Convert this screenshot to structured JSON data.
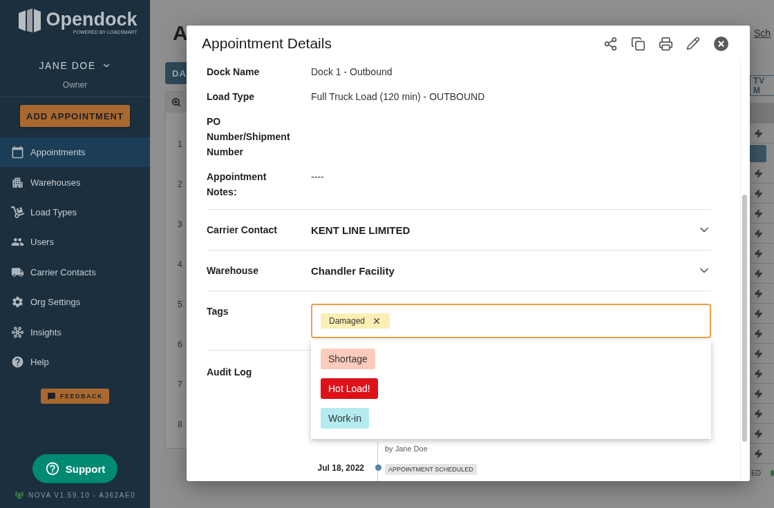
{
  "sidebar": {
    "logo": {
      "name": "Opendock",
      "tagline": "POWERED BY LOADSMART"
    },
    "user": {
      "name": "JANE DOE",
      "role": "Owner"
    },
    "add_button": "ADD APPOINTMENT",
    "nav": [
      {
        "label": "Appointments",
        "selected": true
      },
      {
        "label": "Warehouses",
        "selected": false
      },
      {
        "label": "Load Types",
        "selected": false
      },
      {
        "label": "Users",
        "selected": false
      },
      {
        "label": "Carrier Contacts",
        "selected": false
      },
      {
        "label": "Org Settings",
        "selected": false
      },
      {
        "label": "Insights",
        "selected": false
      },
      {
        "label": "Help",
        "selected": false
      }
    ],
    "feedback": "FEEDBACK",
    "support": "Support",
    "version": "NOVA V1.59.10 - A362AE0"
  },
  "background": {
    "heading": "A",
    "tab": "DA",
    "row_labels": [
      "1",
      "2",
      "3",
      "4",
      "5",
      "6",
      "7",
      "8"
    ],
    "top_link": "Sch",
    "side_button": "TV M",
    "status": "ED"
  },
  "modal": {
    "title": "Appointment Details",
    "details": [
      {
        "label": "Dock Name",
        "value": "Dock 1 - Outbound"
      },
      {
        "label": "Load Type",
        "value": "Full Truck Load (120 min) - OUTBOUND"
      },
      {
        "label": "PO Number/Shipment Number"
      },
      {
        "label": "Appointment Notes:",
        "value": "----"
      }
    ],
    "sections": [
      {
        "label": "Carrier Contact",
        "value": "KENT LINE LIMITED",
        "expanded": false
      },
      {
        "label": "Warehouse",
        "value": "Chandler Facility",
        "expanded": false
      }
    ],
    "tags": {
      "label": "Tags",
      "chips": [
        {
          "label": "Damaged",
          "color": "#fcefb4"
        }
      ],
      "options": [
        {
          "label": "Shortage",
          "color": "#fdcbbb"
        },
        {
          "label": "Hot Load!",
          "color": "#dd1219"
        },
        {
          "label": "Work-in",
          "color": "#b4ebf1"
        }
      ]
    },
    "audit_log": {
      "label": "Audit Log",
      "entries": [
        {
          "by": "by Jane Doe"
        },
        {
          "date": "Jul 18, 2022",
          "event": "APPOINTMENT SCHEDULED"
        }
      ]
    }
  }
}
